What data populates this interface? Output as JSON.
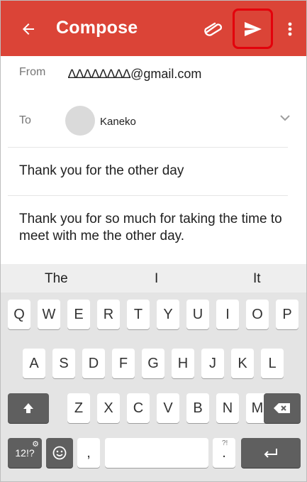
{
  "header": {
    "title": "Compose",
    "back_icon": "arrow-left-icon",
    "attach_icon": "paperclip-icon",
    "send_icon": "send-icon",
    "more_icon": "more-vert-icon",
    "color": "#db4437",
    "highlight_color": "#e3000b"
  },
  "from": {
    "label": "From",
    "value": "∆∆∆∆∆∆∆∆@gmail.com"
  },
  "to": {
    "label": "To",
    "recipient": "Kaneko"
  },
  "subject": "Thank you for the other day",
  "body": "Thank you for so much for taking the time to meet with me the other day.",
  "suggestions": [
    "The",
    "I",
    "It"
  ],
  "keyboard": {
    "row1": [
      "Q",
      "W",
      "E",
      "R",
      "T",
      "Y",
      "U",
      "I",
      "O",
      "P"
    ],
    "row2": [
      "A",
      "S",
      "D",
      "F",
      "G",
      "H",
      "J",
      "K",
      "L"
    ],
    "row3": [
      "Z",
      "X",
      "C",
      "V",
      "B",
      "N",
      "M"
    ],
    "symbols_label": "12!?",
    "comma_label": ",",
    "period_label": ".",
    "period_hint": "?!"
  }
}
